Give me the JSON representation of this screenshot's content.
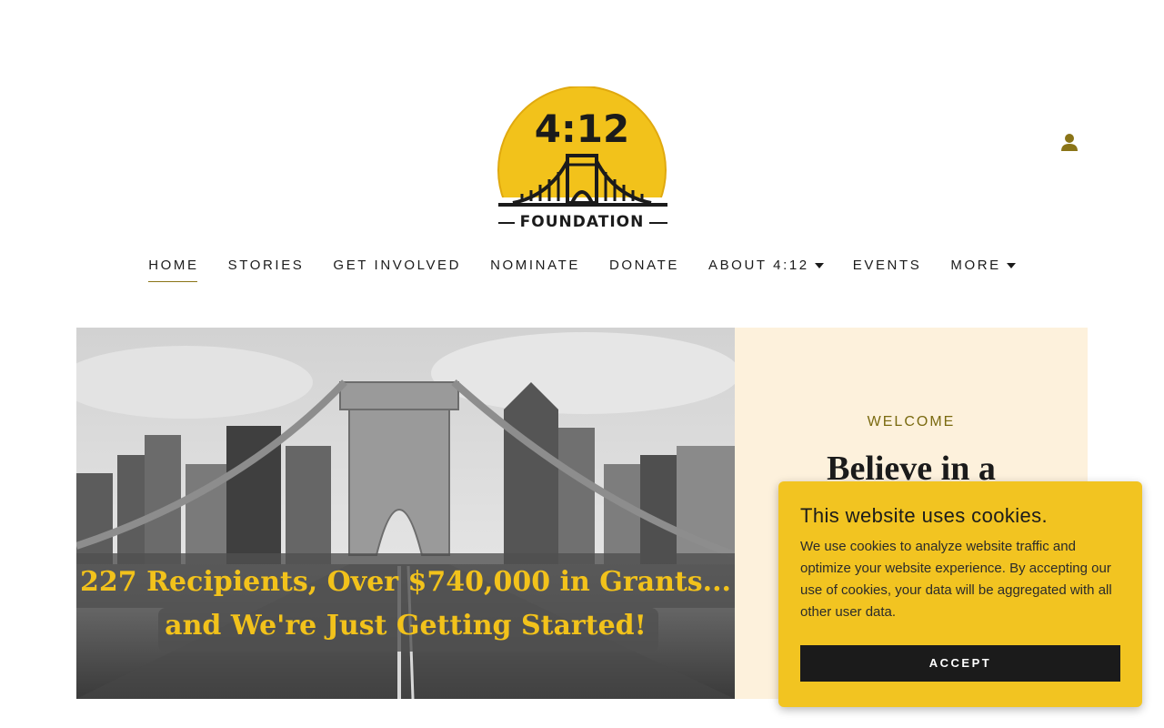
{
  "header": {
    "logo": {
      "number": "4:12",
      "wordmark": "FOUNDATION",
      "colors": {
        "sun": "#f2c21b",
        "ink": "#1b1b1b"
      }
    },
    "account_icon": "person-icon"
  },
  "nav": {
    "items": [
      {
        "label": "HOME",
        "active": true,
        "dropdown": false
      },
      {
        "label": "STORIES",
        "active": false,
        "dropdown": false
      },
      {
        "label": "GET INVOLVED",
        "active": false,
        "dropdown": false
      },
      {
        "label": "NOMINATE",
        "active": false,
        "dropdown": false
      },
      {
        "label": "DONATE",
        "active": false,
        "dropdown": false
      },
      {
        "label": "ABOUT 4:12",
        "active": false,
        "dropdown": true
      },
      {
        "label": "EVENTS",
        "active": false,
        "dropdown": false
      },
      {
        "label": "MORE",
        "active": false,
        "dropdown": true
      }
    ]
  },
  "hero": {
    "banner_line_1": "227 Recipients, Over $740,000 in Grants...",
    "banner_line_2": "and We're Just Getting Started!",
    "welcome_label": "WELCOME",
    "welcome_title": "Believe in a"
  },
  "cookie_banner": {
    "title": "This website uses cookies.",
    "body": "We use cookies to analyze website traffic and optimize your website experience. By accepting our use of cookies, your data will be aggregated with all other user data.",
    "accept_label": "ACCEPT"
  },
  "colors": {
    "accent": "#8a7417",
    "cookie_bg": "#f2c421",
    "welcome_bg": "#fdf1dc",
    "banner_text": "#f2c21b"
  }
}
